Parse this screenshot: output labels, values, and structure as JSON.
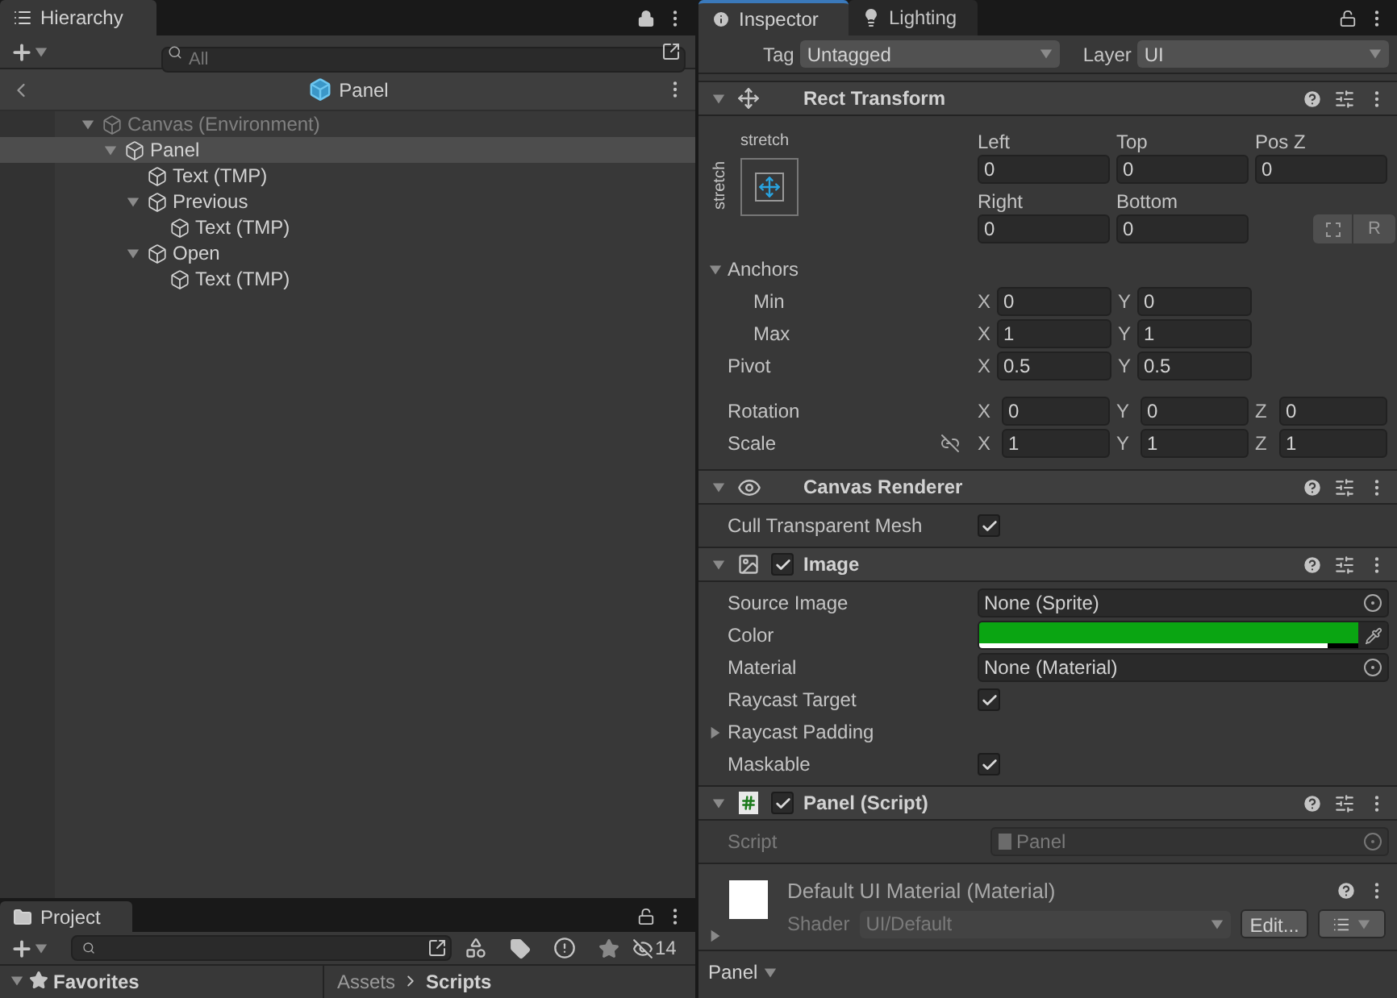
{
  "hierarchy": {
    "title": "Hierarchy",
    "search": {
      "placeholder": "All"
    },
    "breadcrumb": "Panel",
    "tree": [
      {
        "label": "Canvas (Environment)",
        "greyed": true,
        "expanded": true,
        "selected": false,
        "children": [
          {
            "label": "Panel",
            "greyed": false,
            "expanded": true,
            "selected": true,
            "children": [
              {
                "label": "Text (TMP)",
                "greyed": false,
                "selected": false
              },
              {
                "label": "Previous",
                "greyed": false,
                "expanded": true,
                "selected": false,
                "children": [
                  {
                    "label": "Text (TMP)",
                    "greyed": false,
                    "selected": false
                  }
                ]
              },
              {
                "label": "Open",
                "greyed": false,
                "expanded": true,
                "selected": false,
                "children": [
                  {
                    "label": "Text (TMP)",
                    "greyed": false,
                    "selected": false
                  }
                ]
              }
            ]
          }
        ]
      }
    ]
  },
  "project": {
    "title": "Project",
    "hidden_count": "14",
    "favorites": {
      "label": "Favorites",
      "expanded": true
    },
    "breadcrumb": [
      "Assets",
      "Scripts"
    ]
  },
  "inspector": {
    "tabs": [
      {
        "label": "Inspector",
        "selected": true
      },
      {
        "label": "Lighting",
        "selected": false
      }
    ],
    "tag_label": "Tag",
    "tag": "Untagged",
    "layer_label": "Layer",
    "layer": "UI",
    "components": [
      {
        "kind": "rect_transform",
        "title": "Rect Transform",
        "expanded": true,
        "anchor_preset": {
          "top": "stretch",
          "side": "stretch"
        },
        "offsets": [
          {
            "label": "Left",
            "value": "0"
          },
          {
            "label": "Top",
            "value": "0"
          },
          {
            "label": "Pos Z",
            "value": "0"
          },
          {
            "label": "Right",
            "value": "0"
          },
          {
            "label": "Bottom",
            "value": "0"
          }
        ],
        "raw_button": "R",
        "anchors": {
          "label": "Anchors",
          "expanded": true,
          "children": [
            {
              "label": "Min",
              "axes": [
                {
                  "axis": "X",
                  "value": "0"
                },
                {
                  "axis": "Y",
                  "value": "0"
                }
              ]
            },
            {
              "label": "Max",
              "axes": [
                {
                  "axis": "X",
                  "value": "1"
                },
                {
                  "axis": "Y",
                  "value": "1"
                }
              ]
            }
          ]
        },
        "rows": [
          {
            "label": "Pivot",
            "constrain_icon": false,
            "axes": [
              {
                "axis": "X",
                "value": "0.5"
              },
              {
                "axis": "Y",
                "value": "0.5"
              }
            ]
          },
          {
            "label": "Rotation",
            "constrain_icon": false,
            "axes": [
              {
                "axis": "X",
                "value": "0"
              },
              {
                "axis": "Y",
                "value": "0"
              },
              {
                "axis": "Z",
                "value": "0"
              }
            ]
          },
          {
            "label": "Scale",
            "constrain_icon": true,
            "axes": [
              {
                "axis": "X",
                "value": "1"
              },
              {
                "axis": "Y",
                "value": "1"
              },
              {
                "axis": "Z",
                "value": "1"
              }
            ]
          }
        ]
      },
      {
        "kind": "canvas_renderer",
        "title": "Canvas Renderer",
        "expanded": true,
        "props": [
          {
            "kind": "checkbox",
            "label": "Cull Transparent Mesh",
            "checked": true
          }
        ]
      },
      {
        "kind": "image",
        "title": "Image",
        "enabled": true,
        "expanded": true,
        "props": [
          {
            "kind": "object",
            "label": "Source Image",
            "value": "None (Sprite)"
          },
          {
            "kind": "color",
            "label": "Color",
            "color": "#0aa512",
            "level": 0.92
          },
          {
            "kind": "object",
            "label": "Material",
            "value": "None (Material)"
          },
          {
            "kind": "checkbox",
            "label": "Raycast Target",
            "checked": true
          },
          {
            "kind": "foldout",
            "label": "Raycast Padding",
            "expanded": false
          },
          {
            "kind": "checkbox",
            "label": "Maskable",
            "checked": true
          }
        ]
      },
      {
        "kind": "script",
        "title": "Panel (Script)",
        "enabled": true,
        "expanded": true,
        "props": [
          {
            "kind": "script_ref",
            "label": "Script",
            "value": "Panel"
          }
        ]
      }
    ],
    "material": {
      "title": "Default UI Material (Material)",
      "shader_label": "Shader",
      "shader": "UI/Default",
      "edit_button": "Edit...",
      "expanded": false
    },
    "footer_dropdown": "Panel"
  }
}
